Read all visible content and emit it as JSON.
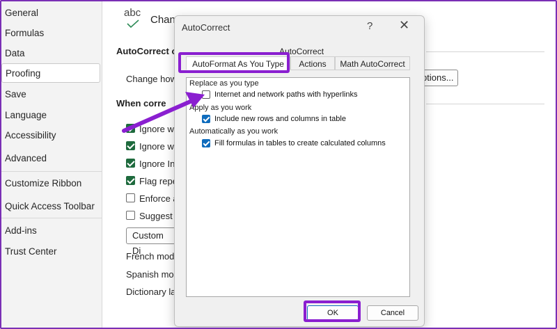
{
  "sidebar": {
    "items": [
      {
        "label": "General"
      },
      {
        "label": "Formulas"
      },
      {
        "label": "Data"
      },
      {
        "label": "Proofing",
        "selected": true
      },
      {
        "label": "Save"
      },
      {
        "label": "Language"
      },
      {
        "label": "Accessibility"
      },
      {
        "label": "Advanced"
      },
      {
        "label": "Customize Ribbon"
      },
      {
        "label": "Quick Access Toolbar"
      },
      {
        "label": "Add-ins"
      },
      {
        "label": "Trust Center"
      }
    ]
  },
  "main": {
    "abc_label": "abc",
    "change_heading": "Chan",
    "autocorrect_section": "AutoCorrect o",
    "change_how": "Change how",
    "when_correcting": "When corre",
    "options": [
      {
        "label": "Ignore w",
        "checked": true
      },
      {
        "label": "Ignore w",
        "checked": true
      },
      {
        "label": "Ignore In",
        "checked": true
      },
      {
        "label": "Flag repe",
        "checked": true
      },
      {
        "label": "Enforce a",
        "checked": false
      },
      {
        "label": "Suggest",
        "checked": false
      }
    ],
    "custom_button": "Custom Di",
    "options_button": "ptions...",
    "french": "French mod",
    "spanish": "Spanish mod",
    "dictionary": "Dictionary la"
  },
  "dialog": {
    "title": "AutoCorrect",
    "help": "?",
    "close": "✕",
    "tabs_top": [
      {
        "label": "AutoCorrect"
      }
    ],
    "tabs_bottom": [
      {
        "label": "AutoFormat As You Type",
        "active": true
      },
      {
        "label": "Actions"
      },
      {
        "label": "Math AutoCorrect"
      }
    ],
    "groups": [
      {
        "heading": "Replace as you type",
        "options": [
          {
            "label": "Internet and network paths with hyperlinks",
            "checked": false
          }
        ]
      },
      {
        "heading": "Apply as you work",
        "options": [
          {
            "label": "Include new rows and columns in table",
            "checked": true
          }
        ]
      },
      {
        "heading": "Automatically as you work",
        "options": [
          {
            "label": "Fill formulas in tables to create calculated columns",
            "checked": true
          }
        ]
      }
    ],
    "ok": "OK",
    "cancel": "Cancel"
  },
  "colors": {
    "highlight": "#8a1fd0",
    "checkbox_blue": "#0f6cbd",
    "checkbox_green": "#1e6a3d"
  }
}
